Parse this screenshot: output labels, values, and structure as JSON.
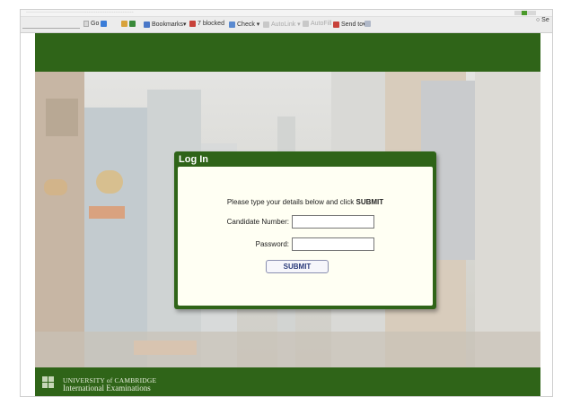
{
  "browser": {
    "status_line": "····························································",
    "toolbar": {
      "go_label": "Go",
      "bookmarks_label": "Bookmarks▾",
      "blocked_label": "7 blocked",
      "check_label": "Check ▾",
      "autolink_label": "AutoLink ▾",
      "autofill_label": "AutoFill",
      "sendto_label": "Send to▾",
      "page_label": "○ Se"
    },
    "colors": {
      "accent": "#2f6418",
      "toolbar_bg": "#ececec"
    }
  },
  "site": {
    "footer": {
      "logo_line1": "UNIVERSITY of CAMBRIDGE",
      "logo_line2": "International Examinations"
    }
  },
  "login": {
    "title": "Log In",
    "instructions_prefix": "Please type your details below and click ",
    "instructions_emphasis": "SUBMIT",
    "candidate_label": "Candidate Number:",
    "candidate_value": "",
    "password_label": "Password:",
    "password_value": "",
    "submit_label": "SUBMIT"
  }
}
